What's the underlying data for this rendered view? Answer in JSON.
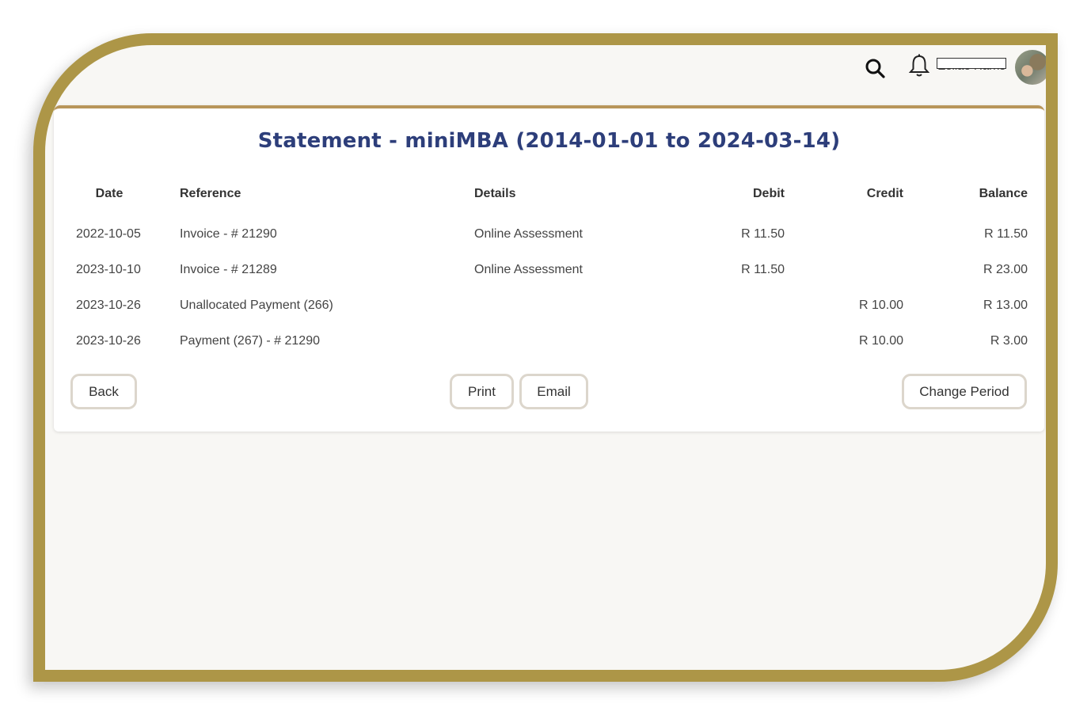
{
  "header": {
    "user_name": "Zeliae Harris",
    "icons": [
      "search-icon",
      "bell-icon",
      "avatar"
    ]
  },
  "statement": {
    "title": "Statement - miniMBA (2014-01-01 to 2024-03-14)",
    "columns": [
      "Date",
      "Reference",
      "Details",
      "Debit",
      "Credit",
      "Balance"
    ],
    "rows": [
      {
        "date": "2022-10-05",
        "reference": "Invoice - # 21290",
        "details": "Online Assessment",
        "debit": "R 11.50",
        "credit": "",
        "balance": "R 11.50"
      },
      {
        "date": "2023-10-10",
        "reference": "Invoice - # 21289",
        "details": "Online Assessment",
        "debit": "R 11.50",
        "credit": "",
        "balance": "R 23.00"
      },
      {
        "date": "2023-10-26",
        "reference": "Unallocated Payment (266)",
        "details": "",
        "debit": "",
        "credit": "R 10.00",
        "balance": "R 13.00"
      },
      {
        "date": "2023-10-26",
        "reference": "Payment (267) - # 21290",
        "details": "",
        "debit": "",
        "credit": "R 10.00",
        "balance": "R 3.00"
      }
    ]
  },
  "buttons": {
    "back": "Back",
    "print": "Print",
    "email": "Email",
    "change_period": "Change Period"
  },
  "colors": {
    "frame": "#ad9647",
    "title": "#2d3e7a",
    "card_accent": "#b8965a",
    "button_border": "#dcd6cc"
  }
}
